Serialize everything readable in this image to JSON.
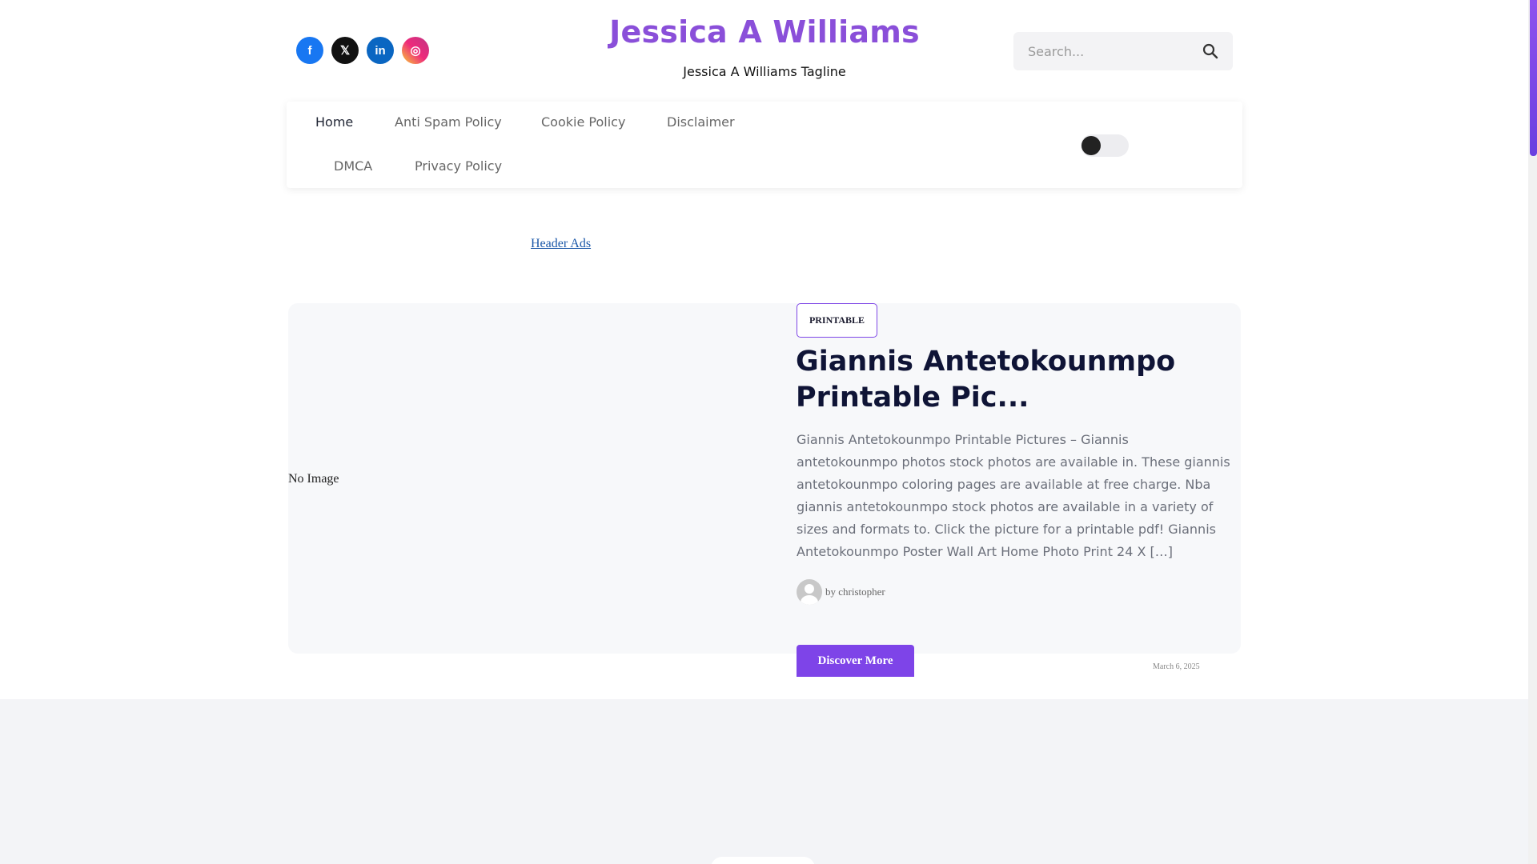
{
  "site": {
    "title": "Jessica A Williams",
    "tagline": "Jessica A Williams Tagline"
  },
  "social": [
    {
      "name": "facebook",
      "label": "f"
    },
    {
      "name": "x",
      "label": "𝕏"
    },
    {
      "name": "linkedin",
      "label": "in"
    },
    {
      "name": "instagram",
      "label": "◎"
    }
  ],
  "search": {
    "placeholder": "Search..."
  },
  "nav": {
    "items": [
      "Home",
      "Anti Spam Policy",
      "Cookie Policy",
      "Disclaimer",
      "DMCA",
      "Privacy Policy"
    ],
    "active": "Home"
  },
  "ads": {
    "header_alt": "Header Ads"
  },
  "post": {
    "image_alt": "No Image",
    "category": "PRINTABLE",
    "title": "Giannis Antetokounmpo Printable Pic...",
    "excerpt": "Giannis Antetokounmpo Printable Pictures – Giannis antetokounmpo photos stock photos are available in. These giannis antetokounmpo coloring pages are available at free charge. Nba giannis antetokounmpo stock photos are available in a variety of sizes and formats to. Click the picture for a printable pdf! Giannis Antetokounmpo Poster Wall Art Home Photo Print 24 X […]",
    "author": "by christopher",
    "cta": "Discover More",
    "date": "March 6, 2025"
  },
  "colors": {
    "brand": "#8a4fd9",
    "accent": "#7e44e8",
    "title": "#0f1436"
  }
}
